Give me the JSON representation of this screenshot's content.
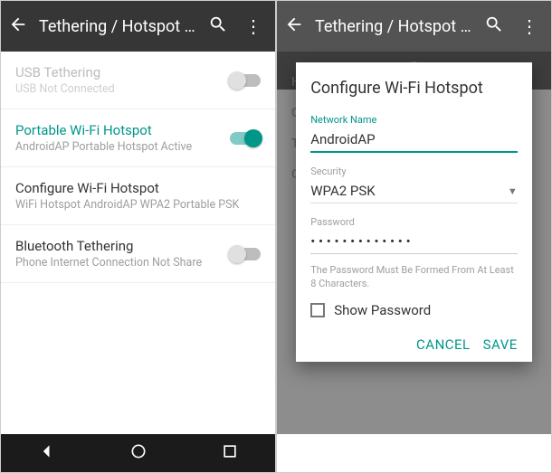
{
  "left": {
    "appbar": {
      "title": "Tethering / Hotspot P..."
    },
    "usb": {
      "title": "USB Tethering",
      "sub": "USB Not Connected"
    },
    "wifi": {
      "title": "Portable Wi-Fi Hotspot",
      "sub": "AndroidAP Portable Hotspot Active"
    },
    "config": {
      "title": "Configure Wi-Fi Hotspot",
      "sub": "WiFi Hotspot AndroidAP WPA2 Portable PSK"
    },
    "bt": {
      "title": "Bluetooth Tethering",
      "sub": "Phone Internet Connection Not Share"
    }
  },
  "right": {
    "appbar": {
      "title": "Tethering / Hotspot P..."
    },
    "bg": {
      "h": "H",
      "c": "C",
      "t": "T",
      "c2": "C"
    },
    "dialog": {
      "title": "Configure Wi-Fi Hotspot",
      "networkLabel": "Network Name",
      "networkValue": "AndroidAP",
      "securityLabel": "Security",
      "securityValue": "WPA2 PSK",
      "passwordLabel": "Password",
      "passwordValue": "• • • • • • • • • • • • •",
      "helper": "The Password Must Be Formed From At Least 8 Characters.",
      "showPassword": "Show Password",
      "cancel": "CANCEL",
      "save": "SAVE"
    }
  }
}
